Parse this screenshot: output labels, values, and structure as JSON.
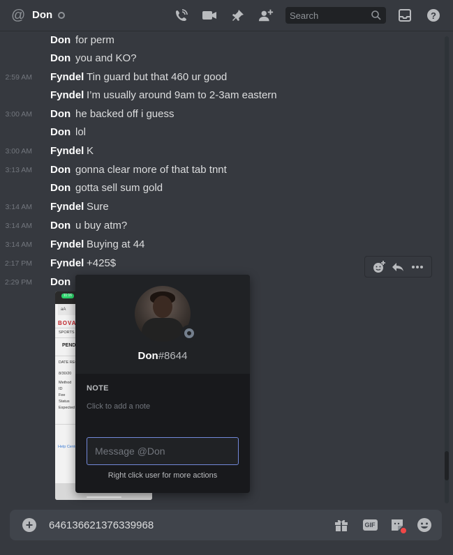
{
  "header": {
    "channel_name": "Don",
    "search_placeholder": "Search"
  },
  "messages": [
    {
      "timestamp": "",
      "author": "Don",
      "text": "for perm"
    },
    {
      "timestamp": "",
      "author": "Don",
      "text": "you and KO?"
    },
    {
      "timestamp": "2:59 AM",
      "author": "Fyndel",
      "text": "Tin guard but that 460 ur good"
    },
    {
      "timestamp": "",
      "author": "Fyndel",
      "text": "I’m usually around 9am to 2-3am eastern"
    },
    {
      "timestamp": "3:00 AM",
      "author": "Don",
      "text": "he backed off i guess"
    },
    {
      "timestamp": "",
      "author": "Don",
      "text": "lol"
    },
    {
      "timestamp": "3:00 AM",
      "author": "Fyndel",
      "text": "K"
    },
    {
      "timestamp": "3:13 AM",
      "author": "Don",
      "text": "gonna clear more of that tab tnnt"
    },
    {
      "timestamp": "",
      "author": "Don",
      "text": "gotta sell sum gold"
    },
    {
      "timestamp": "3:14 AM",
      "author": "Fyndel",
      "text": "Sure"
    },
    {
      "timestamp": "3:14 AM",
      "author": "Don",
      "text": "u buy atm?"
    },
    {
      "timestamp": "3:14 AM",
      "author": "Fyndel",
      "text": "Buying at 44"
    },
    {
      "timestamp": "2:17 PM",
      "author": "Fyndel",
      "text": "+425$"
    },
    {
      "timestamp": "2:29 PM",
      "author": "Don",
      "text": ""
    }
  ],
  "attachment": {
    "phone_time": "11:16",
    "url_text": "aA",
    "brand": "BOVAD",
    "sports_label": "SPORTS",
    "pending_label": "PEND",
    "date_label": "DATE REQ",
    "date_value": "8/30/20",
    "fields": [
      "Method",
      "ID",
      "Fee",
      "Status",
      "Expected"
    ],
    "help_label": "Help Cente"
  },
  "profile_popout": {
    "username": "Don",
    "discriminator": "#8644",
    "note_label": "NOTE",
    "note_hint": "Click to add a note",
    "message_placeholder": "Message @Don",
    "tip": "Right click user for more actions"
  },
  "composer": {
    "value": "646136621376339968",
    "gif_label": "GIF"
  },
  "colors": {
    "background": "#36393f",
    "popout": "#18191c",
    "accent": "#7289da",
    "notification_dot": "#f04747"
  }
}
